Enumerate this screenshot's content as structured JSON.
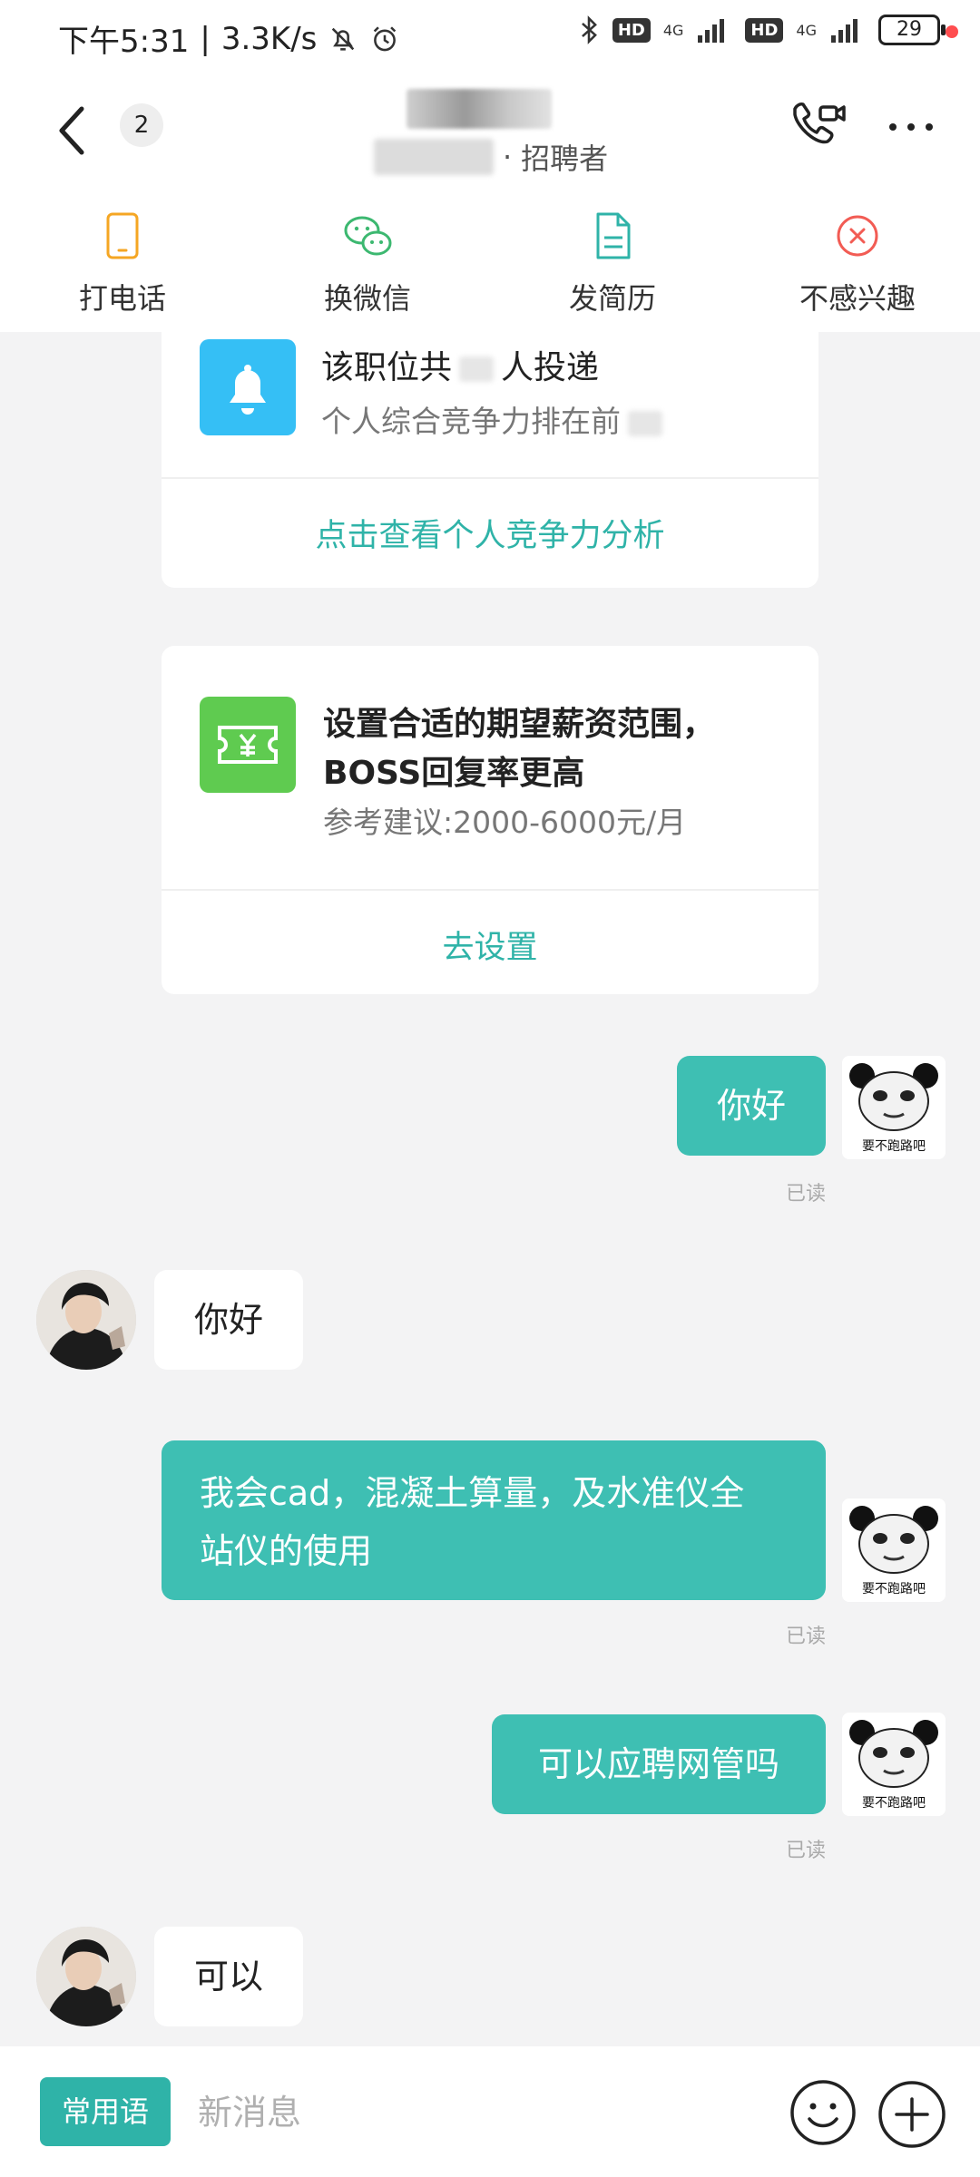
{
  "status_bar": {
    "time": "下午5:31",
    "speed": "3.3K/s",
    "hd1": "HD",
    "net1": "4G",
    "hd2": "HD",
    "net2": "4G",
    "battery": "29"
  },
  "header": {
    "unread_count": "2",
    "role": "招聘者"
  },
  "actions": [
    {
      "label": "打电话",
      "icon": "phone-icon",
      "color": "#f5a623"
    },
    {
      "label": "换微信",
      "icon": "wechat-icon",
      "color": "#3cb870"
    },
    {
      "label": "发简历",
      "icon": "resume-icon",
      "color": "#2fb3a8"
    },
    {
      "label": "不感兴趣",
      "icon": "close-circle-icon",
      "color": "#f25c54"
    }
  ],
  "competitiveness_card": {
    "title_pre": "该职位共",
    "title_post": "人投递",
    "subtitle": "个人综合竞争力排在前",
    "link": "点击查看个人竞争力分析"
  },
  "salary_card": {
    "title_line1": "设置合适的期望薪资范围，",
    "title_line2": "BOSS回复率更高",
    "subtitle": "参考建议:2000-6000元/月",
    "link": "去设置"
  },
  "messages": [
    {
      "from": "me",
      "text": "你好",
      "status": "已读"
    },
    {
      "from": "them",
      "text": "你好"
    },
    {
      "from": "me",
      "text_line1": "我会cad，混凝土算量，及水准仪全",
      "text_line2": "站仪的使用",
      "status": "已读"
    },
    {
      "from": "me",
      "text": "可以应聘网管吗",
      "status": "已读"
    },
    {
      "from": "them",
      "text": "可以"
    }
  ],
  "avatar_caption": "要不跑路吧",
  "input_bar": {
    "quick_phrases": "常用语",
    "placeholder": "新消息"
  },
  "colors": {
    "accent": "#2fb3a8",
    "bubble_me": "#3ebfb3",
    "background": "#f3f3f4"
  }
}
